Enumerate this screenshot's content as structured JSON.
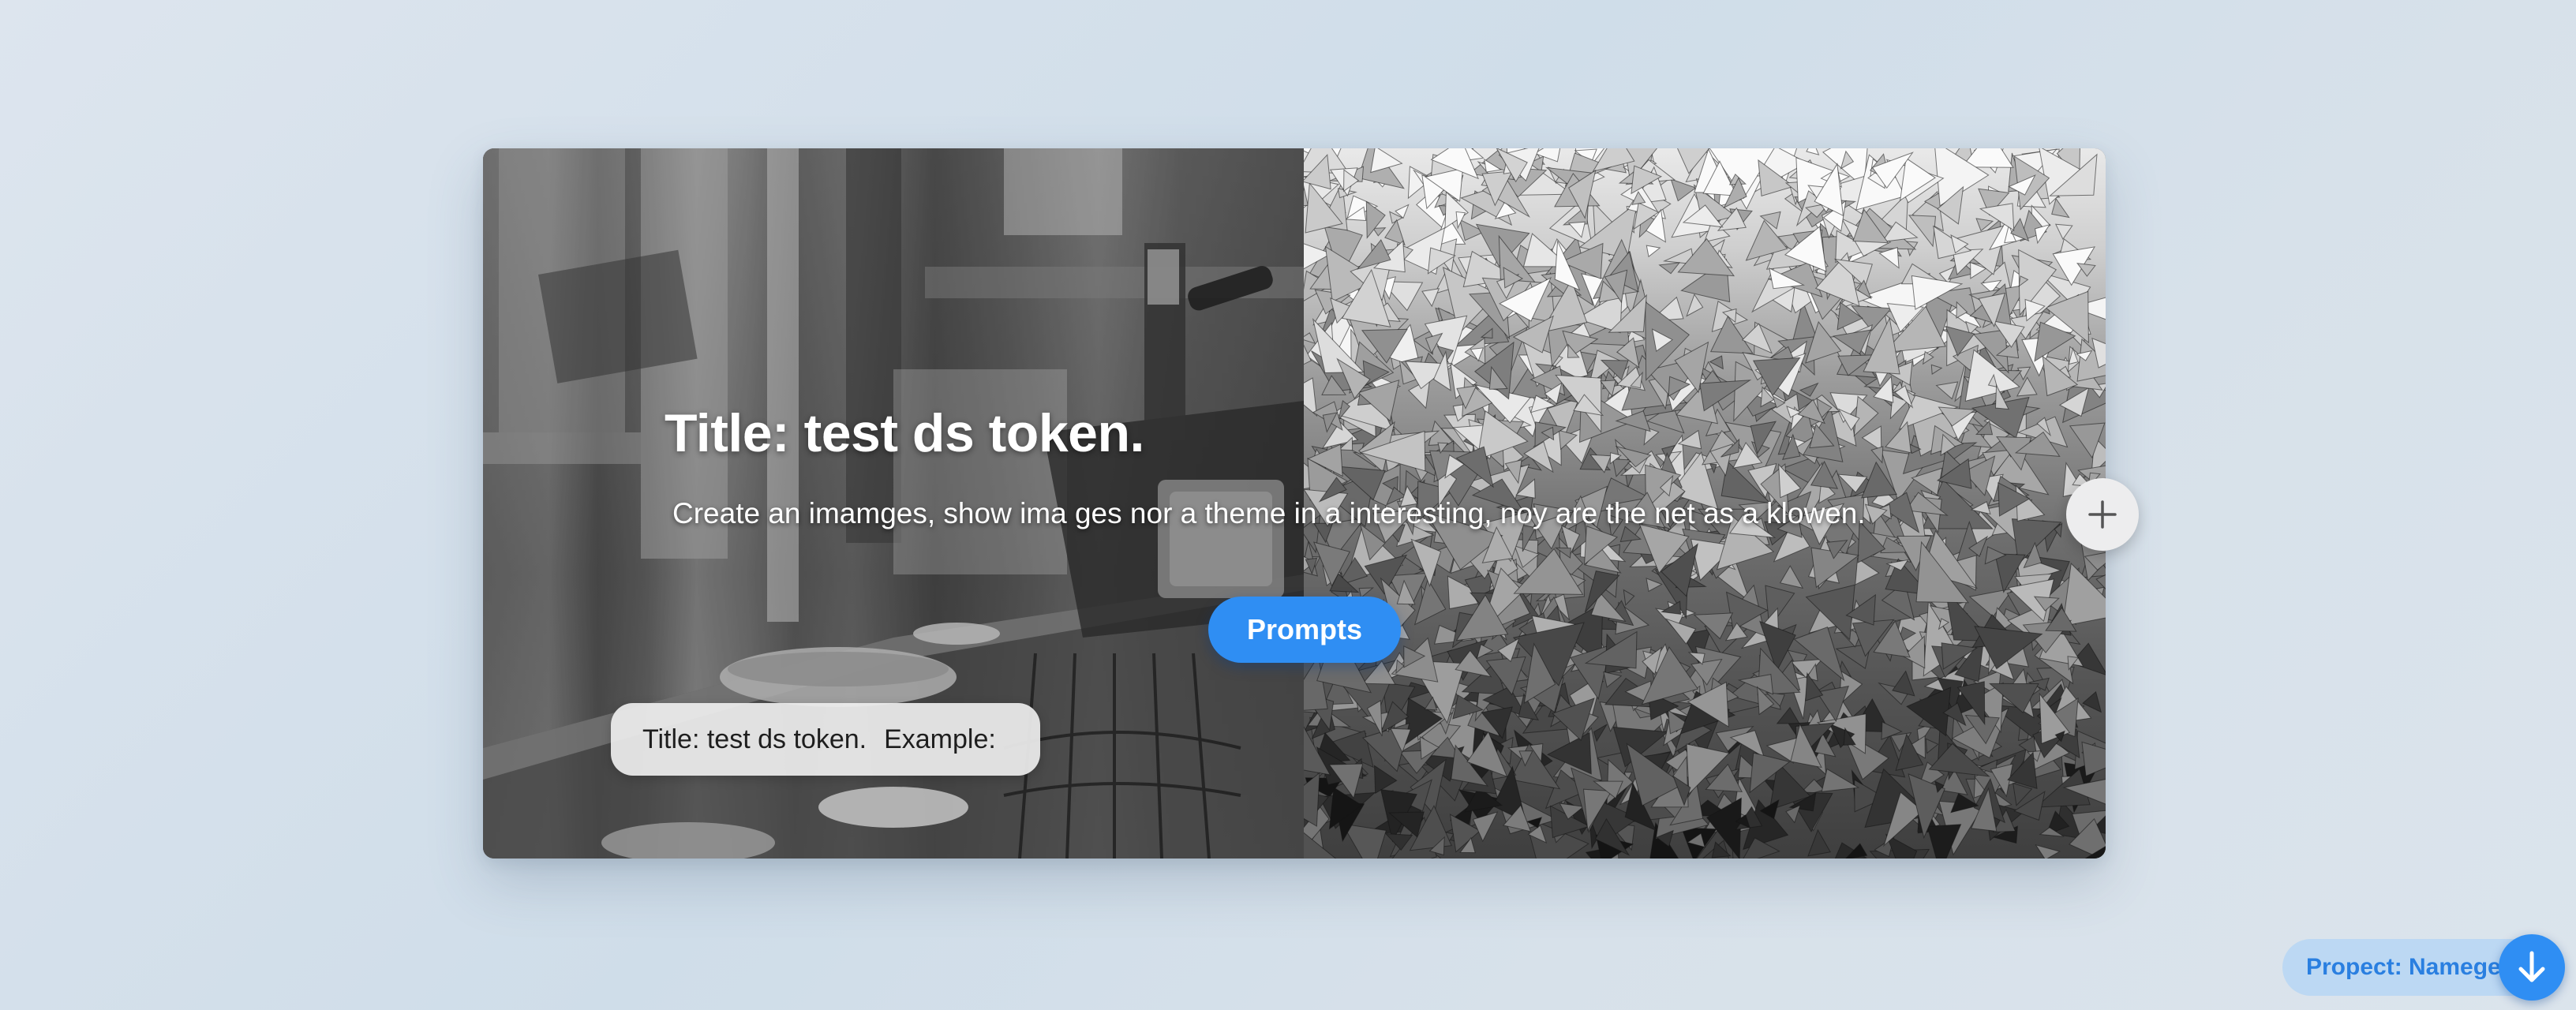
{
  "hero": {
    "title": "Title: test ds token.",
    "subtitle": "Create an imamges, show ima ges nor a theme in a interesting, noy are the net as a klowen.",
    "prompts_button": "Prompts",
    "chip_title": "Title: test ds token.",
    "chip_example": "Example:",
    "left_image": "grayscale-cafe-photo",
    "right_image": "grayscale-crystal-shards-photo"
  },
  "floating": {
    "add_icon": "plus-icon",
    "project_label": "Propect: Namege",
    "download_icon": "arrow-down-icon"
  },
  "colors": {
    "accent": "#2f8ef3",
    "pill_background": "#bcd8f3",
    "pill_text": "#2a7fe0",
    "page_background": "#d5dfe9"
  }
}
